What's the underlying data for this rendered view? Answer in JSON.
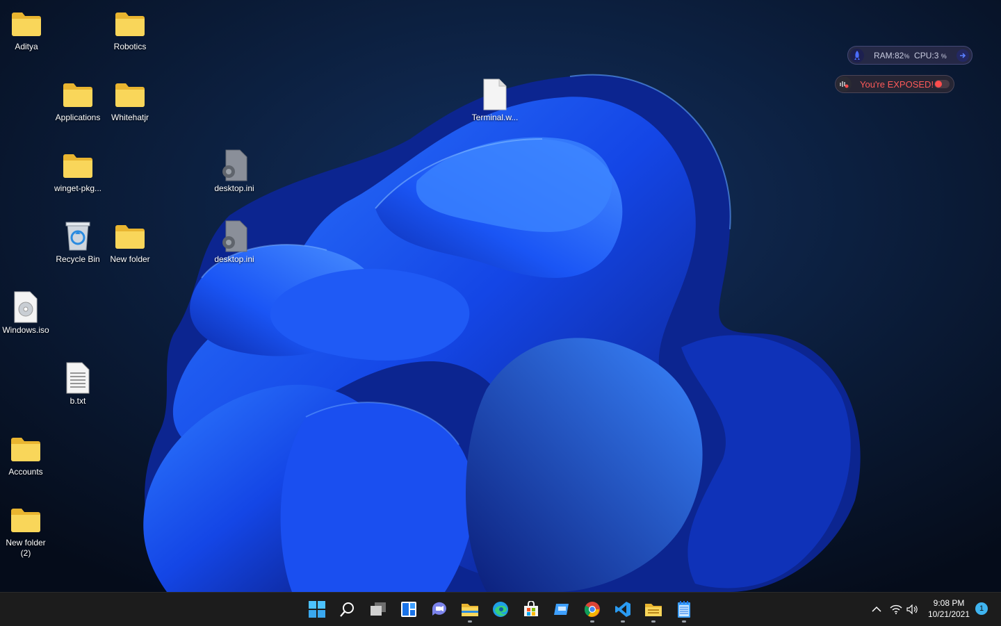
{
  "desktop": {
    "icons": [
      {
        "label": "Aditya",
        "type": "folder"
      },
      {
        "label": "Robotics",
        "type": "folder"
      },
      {
        "label": "Applications",
        "type": "folder"
      },
      {
        "label": "Whitehatjr",
        "type": "folder"
      },
      {
        "label": "Terminal.w...",
        "type": "file"
      },
      {
        "label": "winget-pkg...",
        "type": "folder"
      },
      {
        "label": "desktop.ini",
        "type": "config"
      },
      {
        "label": "Recycle Bin",
        "type": "recycle-bin"
      },
      {
        "label": "New folder",
        "type": "folder"
      },
      {
        "label": "desktop.ini",
        "type": "config"
      },
      {
        "label": "Windows.iso",
        "type": "disc-image"
      },
      {
        "label": "b.txt",
        "type": "text-file"
      },
      {
        "label": "Accounts",
        "type": "folder"
      },
      {
        "label": "New folder\n(2)",
        "type": "folder"
      }
    ]
  },
  "widgets": {
    "system_monitor": {
      "ram_label": "RAM:",
      "ram_value": "82",
      "ram_unit": "%",
      "cpu_label": "CPU:",
      "cpu_value": "3",
      "cpu_unit": "%"
    },
    "privacy": {
      "text": "You're EXPOSED!",
      "status_color": "#ff4d4d"
    }
  },
  "taskbar": {
    "apps": [
      {
        "name": "start-icon",
        "running": false
      },
      {
        "name": "search-icon",
        "running": false
      },
      {
        "name": "task-view-icon",
        "running": false
      },
      {
        "name": "widgets-icon",
        "running": false
      },
      {
        "name": "teams-chat-icon",
        "running": false
      },
      {
        "name": "file-explorer-icon",
        "running": true
      },
      {
        "name": "edge-icon",
        "running": false
      },
      {
        "name": "microsoft-store-icon",
        "running": false
      },
      {
        "name": "app-icon",
        "running": false
      },
      {
        "name": "chrome-icon",
        "running": true
      },
      {
        "name": "vscode-icon",
        "running": true
      },
      {
        "name": "folder-icon",
        "running": true
      },
      {
        "name": "notepad-icon",
        "running": true
      }
    ],
    "tray": {
      "time": "9:08 PM",
      "date": "10/21/2021",
      "notification_count": "1"
    }
  },
  "colors": {
    "accent": "#3fb4f0",
    "folder": "#f5c741",
    "taskbar": "#1c1c1c"
  }
}
